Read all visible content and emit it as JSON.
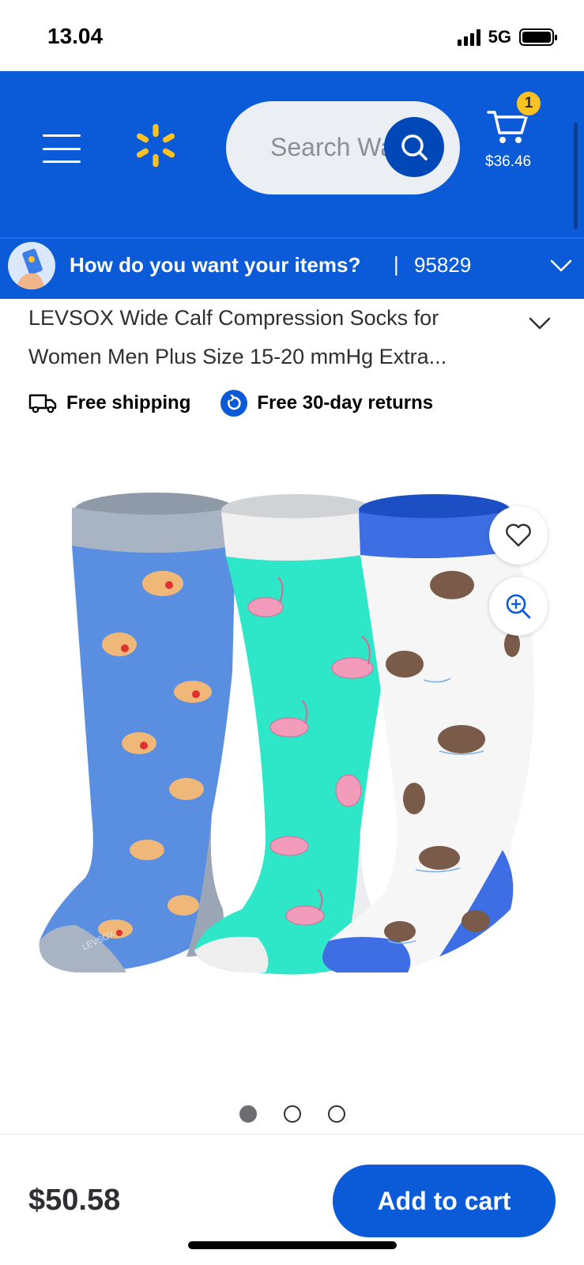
{
  "status_bar": {
    "time": "13.04",
    "network": "5G"
  },
  "header": {
    "search_placeholder": "Search Walmart",
    "search_visible": "Search Wa",
    "cart_count": "1",
    "cart_total": "$36.46"
  },
  "delivery": {
    "question": "How do you want your items?",
    "separator": "|",
    "zip": "95829"
  },
  "product": {
    "title_line1": "LEVSOX Wide Calf Compression Socks for",
    "title_line2": "Women Men Plus Size 15-20 mmHg Extra...",
    "badges": [
      {
        "label": "Free shipping",
        "icon": "truck-icon"
      },
      {
        "label": "Free 30-day returns",
        "icon": "returns-icon"
      }
    ],
    "sock_brand_text": "LEVSOX",
    "image_count": 3,
    "active_image": 1,
    "price": "$50.58",
    "add_to_cart_label": "Add to cart"
  },
  "colors": {
    "brand_blue": "#0b5bd9",
    "spark_yellow": "#ffc220",
    "sock_blue": "#5a8ee0",
    "sock_teal": "#2ee6c8",
    "sock_white": "#f6f6f6"
  }
}
